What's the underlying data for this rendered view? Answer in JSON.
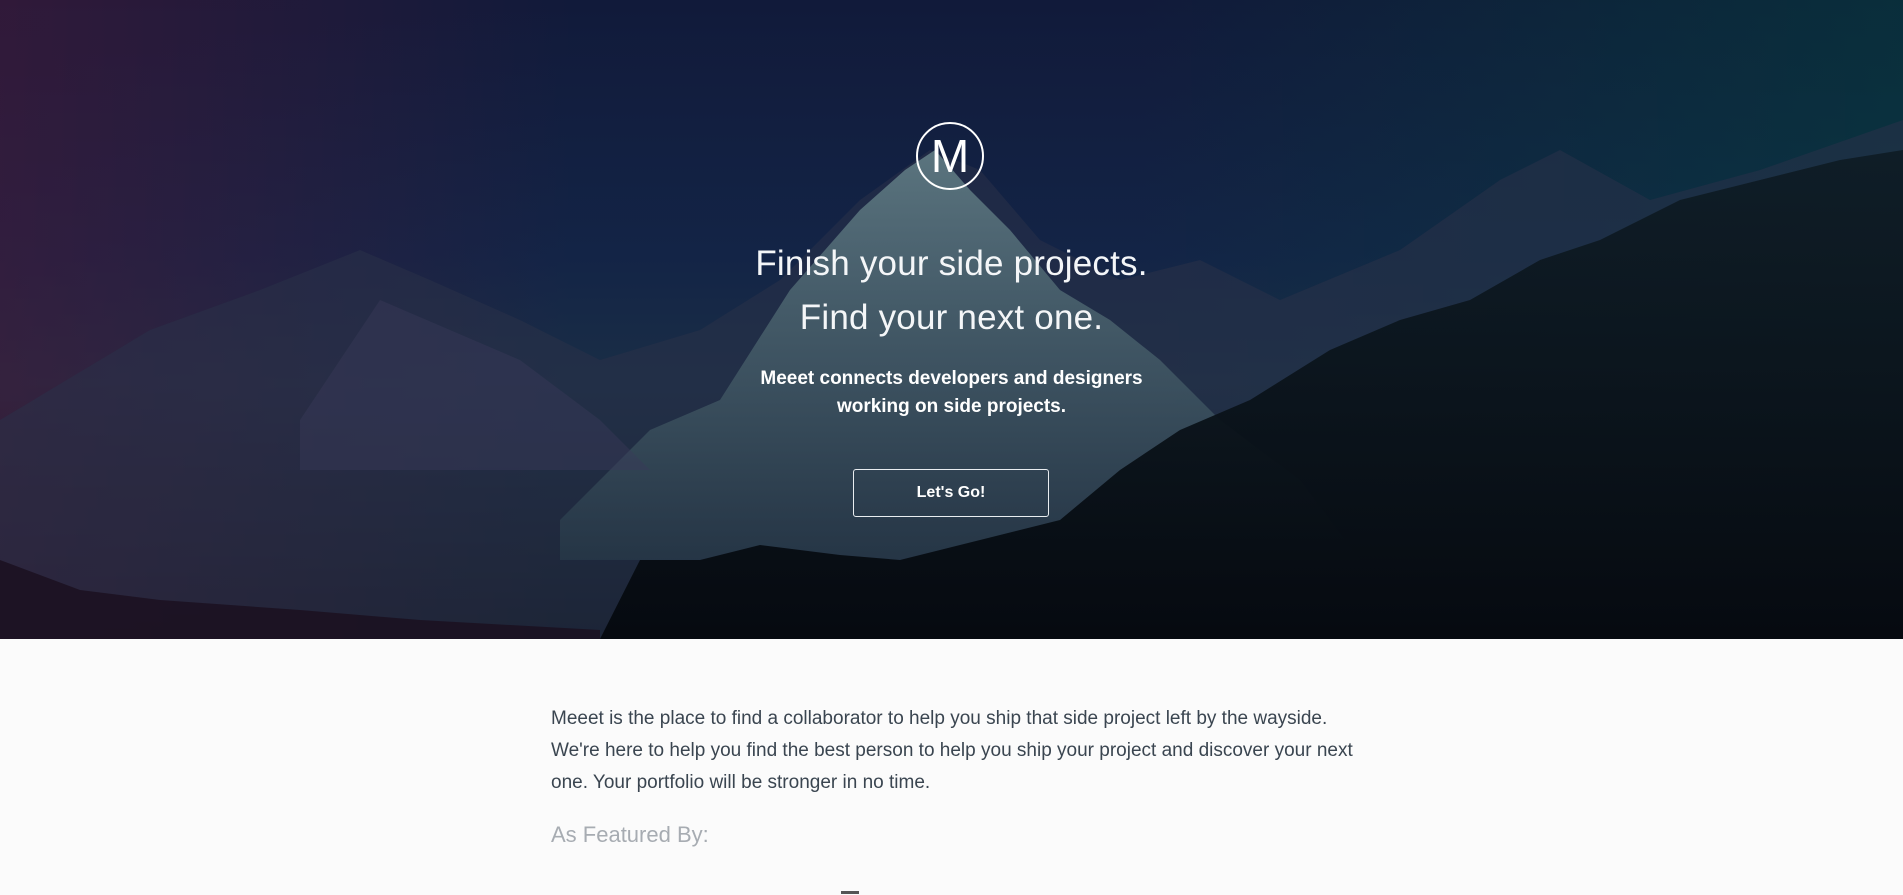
{
  "hero": {
    "logo_letter": "M",
    "headline_line1": "Finish your side projects.",
    "headline_line2": "Find your next one.",
    "subheadline": "Meeet connects developers and designers working on side projects.",
    "cta_label": "Let's Go!"
  },
  "about": {
    "description": "Meeet is the place to find a collaborator to help you ship that side project left by the wayside. We're here to help you find the best person to help you ship your project and discover your next one. Your portfolio will be stronger in no time.",
    "featured_label": "As Featured By:"
  },
  "colors": {
    "hero_left_tint": "#4a1838",
    "hero_center": "#132446",
    "hero_right_tint": "#00463c",
    "body_background": "#fbfbfb",
    "body_text": "#3a4550",
    "muted_text": "#a7acb2"
  }
}
